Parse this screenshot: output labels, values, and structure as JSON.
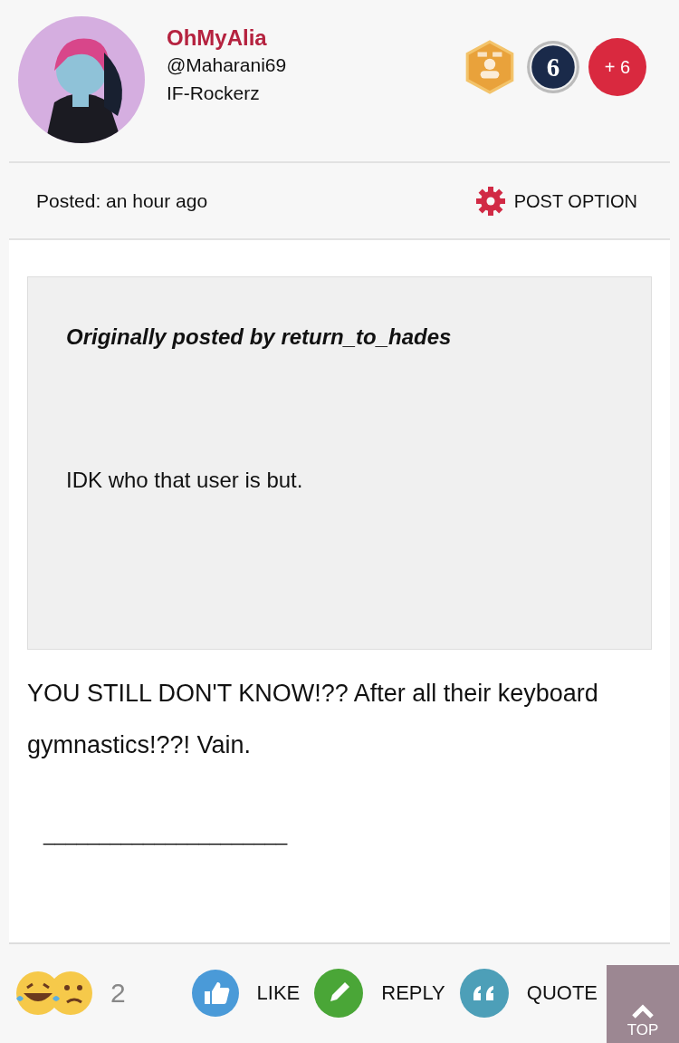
{
  "author": {
    "name": "OhMyAlia",
    "handle": "@Maharani69",
    "group": "IF-Rockerz"
  },
  "badges": [
    {
      "kind": "hexagon"
    },
    {
      "kind": "medal",
      "label": "6"
    },
    {
      "kind": "more",
      "label": "+ 6"
    }
  ],
  "post_meta": {
    "posted": "Posted: an hour ago",
    "option": "POST OPTION"
  },
  "quote": {
    "attribution": "Originally posted by return_to_hades",
    "text": "IDK who that user is but."
  },
  "body": {
    "text": "YOU STILL DON'T KNOW!?? After all their keyboard gymnastics!??! Vain.",
    "signature": "______________________"
  },
  "reactions": {
    "count": "2"
  },
  "actions": [
    {
      "kind": "like",
      "label": "LIKE"
    },
    {
      "kind": "reply",
      "label": "REPLY"
    },
    {
      "kind": "quote",
      "label": "QUOTE"
    }
  ],
  "top_button": {
    "label": "TOP"
  }
}
